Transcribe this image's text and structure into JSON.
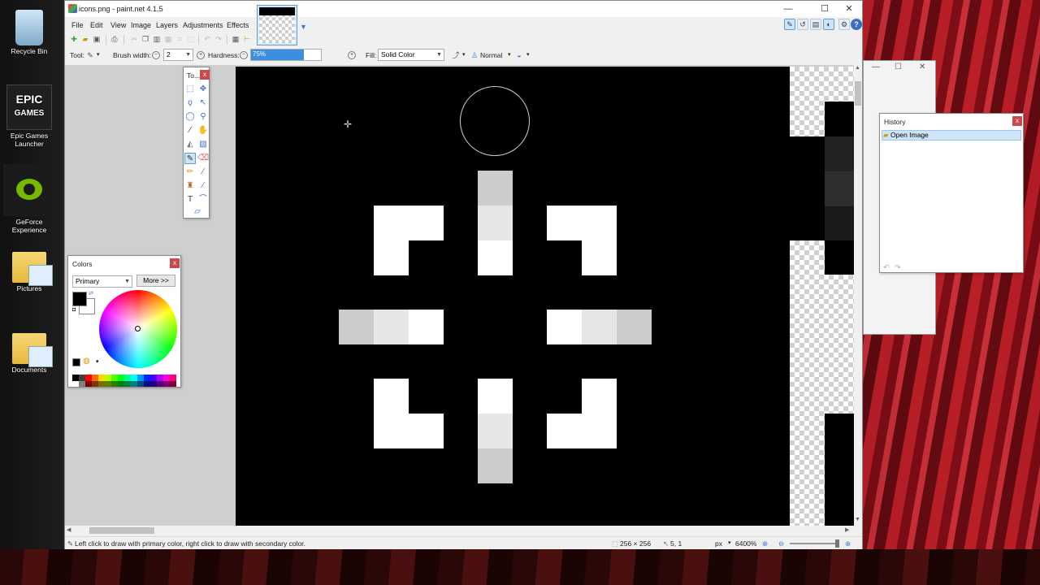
{
  "desktop": {
    "icons": [
      {
        "label": "Recycle Bin"
      },
      {
        "label": "Epic Games Launcher",
        "logo_text_1": "EPIC",
        "logo_text_2": "GAMES"
      },
      {
        "label": "GeForce Experience"
      },
      {
        "label": "Pictures"
      },
      {
        "label": "Documents"
      }
    ]
  },
  "window": {
    "title": "icons.png - paint.net 4.1.5",
    "menu": [
      "File",
      "Edit",
      "View",
      "Image",
      "Layers",
      "Adjustments",
      "Effects"
    ]
  },
  "tool_options": {
    "tool_label": "Tool:",
    "brush_width_label": "Brush width:",
    "brush_width_value": "2",
    "hardness_label": "Hardness:",
    "hardness_value": "75%",
    "hardness_fraction": 0.75,
    "fill_label": "Fill:",
    "fill_value": "Solid Color",
    "blend_mode": "Normal"
  },
  "tools_panel": {
    "title": "To..."
  },
  "colors_panel": {
    "title": "Colors",
    "selector": "Primary",
    "more_button": "More >>",
    "primary_color": "#000000",
    "secondary_color": "#ffffff",
    "palette": [
      "#000000",
      "#404040",
      "#ff0000",
      "#ff6a00",
      "#ffd800",
      "#b6ff00",
      "#4cff00",
      "#00ff21",
      "#00ff90",
      "#00ffff",
      "#0094ff",
      "#0026ff",
      "#4800ff",
      "#b200ff",
      "#ff00dc",
      "#ff006e",
      "#ffffff",
      "#808080",
      "#7f0000",
      "#7f3300",
      "#7f6a00",
      "#5b7f00",
      "#267f00",
      "#007f0e",
      "#007f46",
      "#007f7f",
      "#004a7f",
      "#00137f",
      "#21007f",
      "#57007f",
      "#7f006e",
      "#7f0037"
    ]
  },
  "history_panel": {
    "title": "History",
    "items": [
      "Open Image"
    ]
  },
  "status": {
    "hint": "Left click to draw with primary color, right click to draw with secondary color.",
    "image_size": "256 × 256",
    "cursor_pos": "5, 1",
    "units": "px",
    "zoom": "6400%"
  },
  "colors": {
    "accent": "#3c8ee0",
    "canvas_bg": "#000000",
    "pixel_white": "#ffffff",
    "pixel_light": "#e6e6e6",
    "pixel_mid": "#cccccc"
  }
}
